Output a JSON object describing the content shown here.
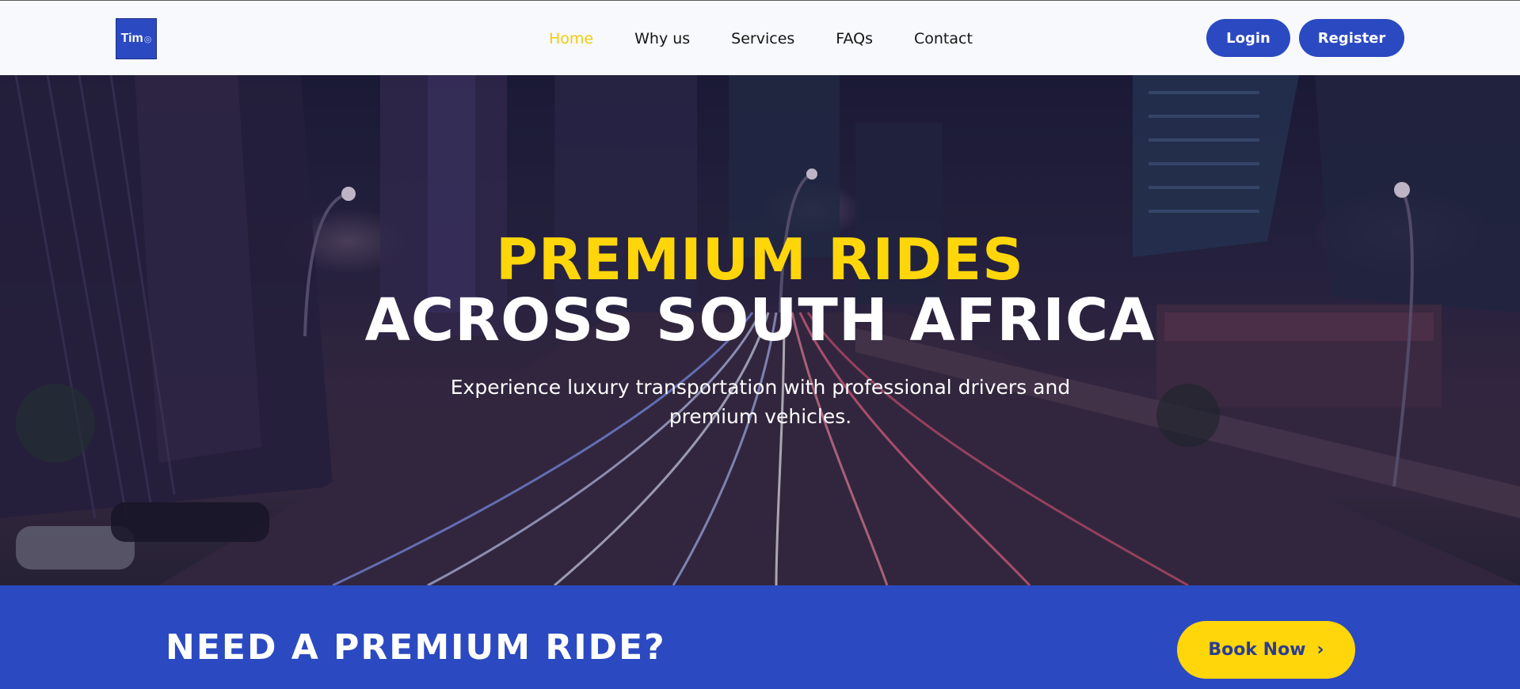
{
  "header": {
    "logo_text": "Tim",
    "nav": [
      {
        "label": "Home",
        "active": true
      },
      {
        "label": "Why us",
        "active": false
      },
      {
        "label": "Services",
        "active": false
      },
      {
        "label": "FAQs",
        "active": false
      },
      {
        "label": "Contact",
        "active": false
      }
    ],
    "login_label": "Login",
    "register_label": "Register"
  },
  "hero": {
    "title_line1": "PREMIUM RIDES",
    "title_line2": "ACROSS SOUTH AFRICA",
    "subtitle": "Experience luxury transportation with professional drivers and premium vehicles."
  },
  "cta": {
    "title": "NEED A PREMIUM RIDE?",
    "button_label": "Book Now",
    "button_icon": "chevron-right-icon"
  },
  "colors": {
    "brand_blue": "#2b49c0",
    "accent_yellow": "#ffd60a",
    "nav_active": "#f3cb0c",
    "header_bg": "#f7f9fc"
  }
}
